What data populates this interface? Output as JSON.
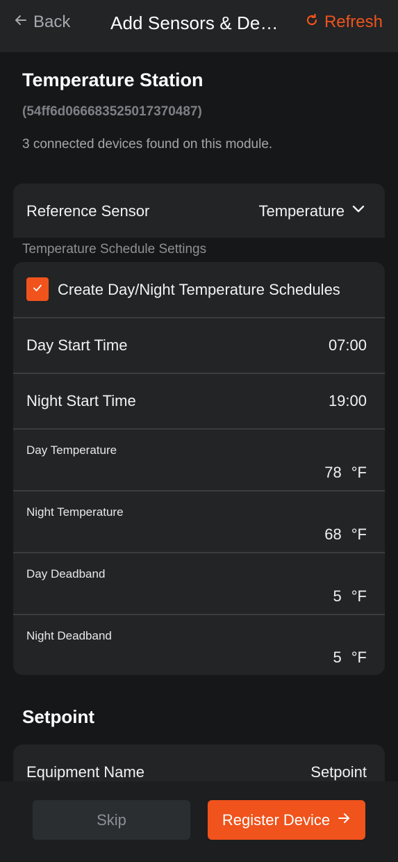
{
  "header": {
    "back_label": "Back",
    "title": "Add Sensors & Devi...",
    "refresh_label": "Refresh"
  },
  "module": {
    "name": "Temperature Station",
    "id": "(54ff6d066683525017370487)",
    "status": "3 connected devices found on this module."
  },
  "reference": {
    "label": "Reference Sensor",
    "value": "Temperature"
  },
  "schedule": {
    "section_label": "Temperature Schedule Settings",
    "checkbox_label": "Create Day/Night Temperature Schedules",
    "checkbox_checked": true,
    "day_start_label": "Day Start Time",
    "day_start_value": "07:00",
    "night_start_label": "Night Start Time",
    "night_start_value": "19:00",
    "day_temp_label": "Day Temperature",
    "day_temp_value": "78",
    "night_temp_label": "Night Temperature",
    "night_temp_value": "68",
    "day_deadband_label": "Day Deadband",
    "day_deadband_value": "5",
    "night_deadband_label": "Night Deadband",
    "night_deadband_value": "5",
    "unit": "°F"
  },
  "setpoint": {
    "title": "Setpoint",
    "equipment_label": "Equipment Name",
    "equipment_value": "Setpoint"
  },
  "actions": {
    "skip_label": "Skip",
    "register_label": "Register Device"
  },
  "colors": {
    "accent": "#f0531c",
    "background": "#161718",
    "card": "#222426"
  },
  "icons": {
    "back": "arrow-left-icon",
    "refresh": "refresh-icon",
    "dropdown": "chevron-down-icon",
    "check": "check-icon",
    "register": "arrow-right-icon"
  }
}
